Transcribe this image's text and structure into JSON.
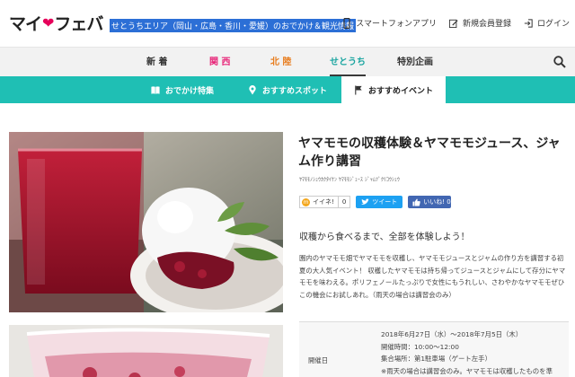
{
  "header": {
    "logo_left": "マイ",
    "logo_right": "フェバ",
    "tagline": "せとうちエリア（岡山・広島・香川・愛媛）のおでかけ＆観光情報",
    "links": [
      {
        "label": "スマートフォンアプリ",
        "icon": "smartphone-icon"
      },
      {
        "label": "新規会員登録",
        "icon": "register-icon"
      },
      {
        "label": "ログイン",
        "icon": "login-icon"
      }
    ]
  },
  "region_nav": {
    "tabs": [
      {
        "label": "新 着",
        "color": "#333333"
      },
      {
        "label": "関 西",
        "color": "#e8287a"
      },
      {
        "label": "北 陸",
        "color": "#e87d1e"
      },
      {
        "label": "せとうち",
        "color": "#1aa5a0",
        "active": true
      },
      {
        "label": "特別企画",
        "color": "#333333"
      }
    ],
    "search_icon": "search-icon"
  },
  "sub_nav": {
    "items": [
      {
        "label": "おでかけ特集",
        "icon": "book-icon"
      },
      {
        "label": "おすすめスポット",
        "icon": "pin-icon"
      },
      {
        "label": "おすすめイベント",
        "icon": "flag-icon",
        "active": true
      }
    ],
    "color": "#1fbfb4"
  },
  "article": {
    "title": "ヤマモモの収穫体験＆ヤマモモジュース、ジャム作り講習",
    "tags": "ﾔﾏﾓﾓﾉｼｭｳｶｸﾀｲｹﾝ ﾔﾏﾓﾓｼﾞｭｰｽ ｼﾞｬﾑﾂﾞｸﾘｺｳｼｭｳ",
    "social": {
      "iine_label": "イイネ!",
      "iine_count": "0",
      "tweet_label": "ツイート",
      "fb_label": "いいね! 0",
      "fb_count": "0"
    },
    "lead": "収穫から食べるまで、全部を体験しよう！",
    "description": "園内のヤマモモ畑でヤマモモを収穫し、ヤマモモジュースとジャムの作り方を講習する初夏の大人気イベント！ 収穫したヤマモモは持ち帰ってジュースとジャムにして存分にヤマモモを味わえる。ポリフェノールたっぷりで女性にもうれしい、さわやかなヤマモモぜひこの機会にお試しあれ。（雨天の場合は講習会のみ）",
    "info": {
      "label": "開催日",
      "lines": [
        "2018年6月27日（水）～2018年7月5日（木）",
        "開催時間：10:00～12:00",
        "集合場所：第1駐車場（ゲート左手）",
        "※雨天の場合は講習会のみ。ヤマモモは収穫したものを準"
      ]
    }
  }
}
